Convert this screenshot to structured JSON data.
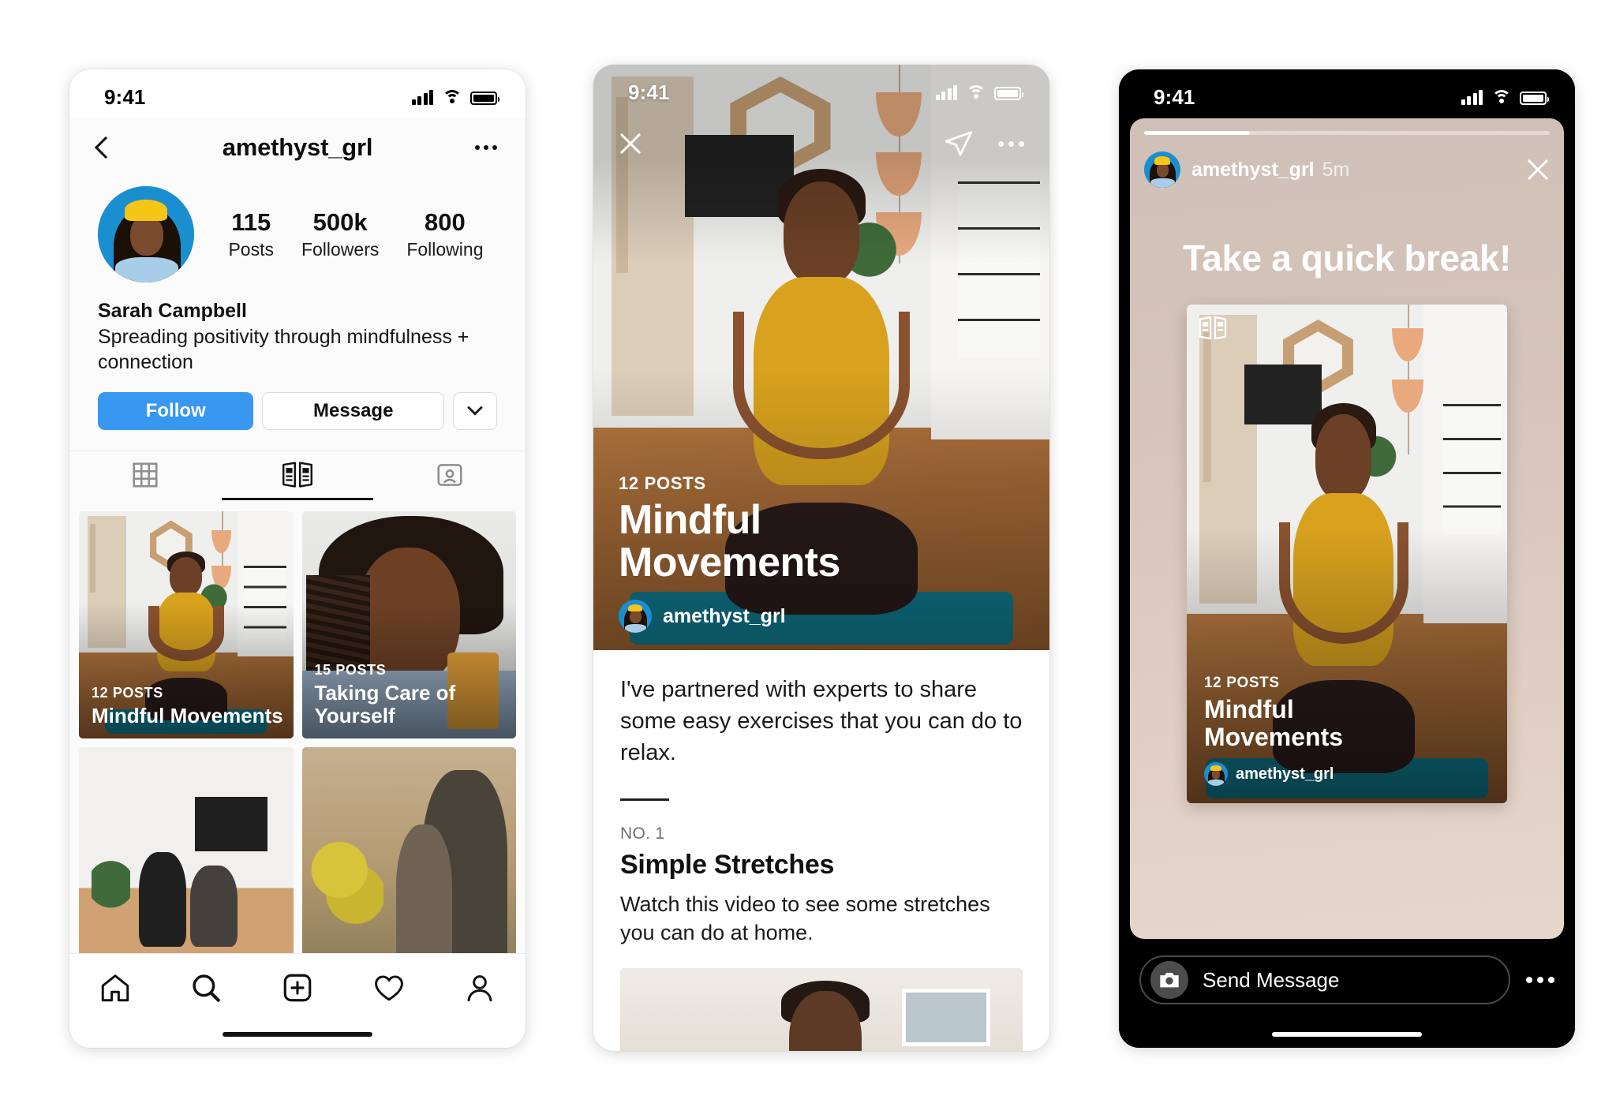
{
  "phone1": {
    "status": {
      "time": "9:41"
    },
    "nav": {
      "title": "amethyst_grl",
      "back_icon": "chevron-left-icon",
      "more_icon": "more-horizontal-icon"
    },
    "stats": [
      {
        "value": "115",
        "label": "Posts"
      },
      {
        "value": "500k",
        "label": "Followers"
      },
      {
        "value": "800",
        "label": "Following"
      }
    ],
    "profile": {
      "display_name": "Sarah Campbell",
      "bio": "Spreading positivity through mindfulness + connection"
    },
    "actions": {
      "follow_label": "Follow",
      "message_label": "Message",
      "more_icon": "chevron-down-icon",
      "follow_color": "#3897f0"
    },
    "tabs": [
      {
        "id": "grid",
        "icon": "grid-icon",
        "active": false
      },
      {
        "id": "guides",
        "icon": "guides-book-icon",
        "active": true
      },
      {
        "id": "tagged",
        "icon": "tagged-person-icon",
        "active": false
      }
    ],
    "guides": [
      {
        "posts": "12 POSTS",
        "title": "Mindful Movements",
        "scene": "yoga"
      },
      {
        "posts": "15 POSTS",
        "title": "Taking Care of Yourself",
        "scene": "portrait"
      },
      {
        "posts": "",
        "title": "",
        "scene": "stretch"
      },
      {
        "posts": "",
        "title": "",
        "scene": "outdoor"
      }
    ],
    "tabbar": [
      {
        "id": "home",
        "icon": "home-icon"
      },
      {
        "id": "search",
        "icon": "search-icon"
      },
      {
        "id": "create",
        "icon": "plus-square-icon"
      },
      {
        "id": "activity",
        "icon": "heart-icon"
      },
      {
        "id": "profile",
        "icon": "person-icon"
      }
    ]
  },
  "phone2": {
    "status": {
      "time": "9:41"
    },
    "topbar": {
      "close_icon": "close-x-icon",
      "share_icon": "send-paperplane-icon",
      "more_icon": "more-horizontal-icon"
    },
    "hero": {
      "posts": "12 POSTS",
      "title_line1": "Mindful",
      "title_line2": "Movements",
      "username": "amethyst_grl"
    },
    "content": {
      "lede": "I've partnered with experts to share some easy exercises that you can do to relax.",
      "item_number": "NO. 1",
      "item_title": "Simple Stretches",
      "item_body": "Watch this video to see some stretches you can do at home."
    }
  },
  "phone3": {
    "status": {
      "time": "9:41"
    },
    "header": {
      "username": "amethyst_grl",
      "timestamp": "5m",
      "close_icon": "close-x-icon"
    },
    "story": {
      "headline": "Take a quick break!",
      "progress_percent": 26
    },
    "sticker": {
      "guide_icon": "guides-book-icon",
      "posts": "12 POSTS",
      "title_line1": "Mindful",
      "title_line2": "Movements",
      "username": "amethyst_grl"
    },
    "footer": {
      "camera_icon": "camera-icon",
      "message_placeholder": "Send Message",
      "more_icon": "more-horizontal-icon"
    }
  }
}
